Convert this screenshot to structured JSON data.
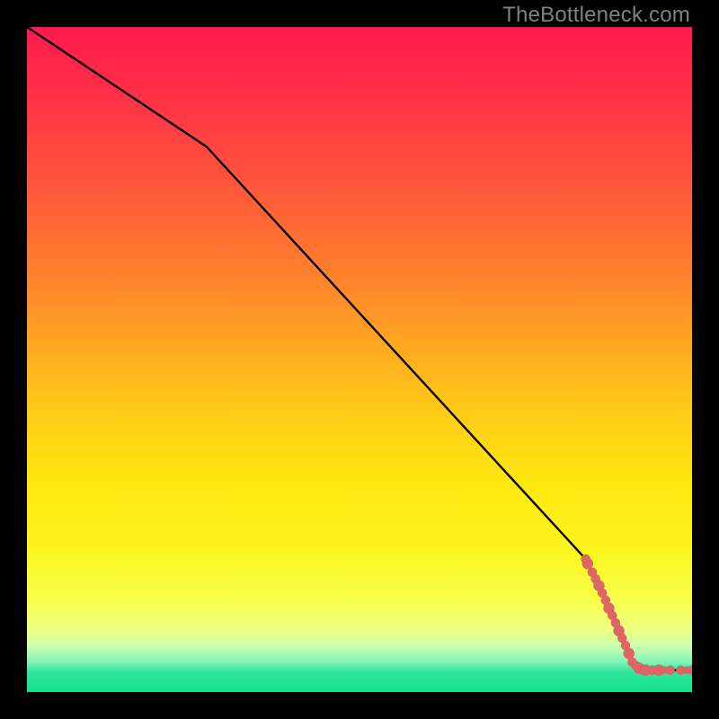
{
  "watermark": "TheBottleneck.com",
  "colors": {
    "line": "#000000",
    "dot_fill": "#e06666",
    "dot_stroke": "#d65a5a",
    "plot_border": "#000000"
  },
  "chart_data": {
    "type": "line",
    "title": "",
    "xlabel": "",
    "ylabel": "",
    "xlim": [
      0,
      100
    ],
    "ylim": [
      0,
      100
    ],
    "line": [
      {
        "x": 0,
        "y": 100
      },
      {
        "x": 27,
        "y": 82
      },
      {
        "x": 84,
        "y": 20
      },
      {
        "x": 91,
        "y": 4.5
      },
      {
        "x": 93,
        "y": 3.3
      },
      {
        "x": 100,
        "y": 3.3
      }
    ],
    "dots": [
      {
        "x": 84.0,
        "y": 20.0,
        "r": 5
      },
      {
        "x": 84.3,
        "y": 19.3,
        "r": 6
      },
      {
        "x": 85.0,
        "y": 18.0,
        "r": 5
      },
      {
        "x": 85.5,
        "y": 17.0,
        "r": 5
      },
      {
        "x": 86.0,
        "y": 16.0,
        "r": 6
      },
      {
        "x": 86.5,
        "y": 14.9,
        "r": 5
      },
      {
        "x": 87.0,
        "y": 13.8,
        "r": 5
      },
      {
        "x": 87.5,
        "y": 12.6,
        "r": 6
      },
      {
        "x": 88.0,
        "y": 11.5,
        "r": 5
      },
      {
        "x": 88.5,
        "y": 10.4,
        "r": 5
      },
      {
        "x": 89.0,
        "y": 9.2,
        "r": 6
      },
      {
        "x": 89.5,
        "y": 8.1,
        "r": 5
      },
      {
        "x": 90.0,
        "y": 7.0,
        "r": 5
      },
      {
        "x": 90.5,
        "y": 5.8,
        "r": 6
      },
      {
        "x": 91.0,
        "y": 4.5,
        "r": 5
      },
      {
        "x": 91.5,
        "y": 4.0,
        "r": 5
      },
      {
        "x": 92.0,
        "y": 3.6,
        "r": 6
      },
      {
        "x": 92.5,
        "y": 3.4,
        "r": 5
      },
      {
        "x": 93.0,
        "y": 3.3,
        "r": 6
      },
      {
        "x": 94.0,
        "y": 3.3,
        "r": 5
      },
      {
        "x": 95.0,
        "y": 3.3,
        "r": 6
      },
      {
        "x": 95.8,
        "y": 3.3,
        "r": 4
      },
      {
        "x": 96.7,
        "y": 3.3,
        "r": 5
      },
      {
        "x": 98.3,
        "y": 3.3,
        "r": 5
      },
      {
        "x": 99.2,
        "y": 3.3,
        "r": 4
      },
      {
        "x": 100,
        "y": 3.3,
        "r": 5
      }
    ],
    "gradient_stops": [
      {
        "p": 0.0,
        "c": "#ff1a4d"
      },
      {
        "p": 0.1,
        "c": "#ff3047"
      },
      {
        "p": 0.25,
        "c": "#ff5a3a"
      },
      {
        "p": 0.4,
        "c": "#ff8a2a"
      },
      {
        "p": 0.55,
        "c": "#ffc21a"
      },
      {
        "p": 0.68,
        "c": "#ffe60f"
      },
      {
        "p": 0.78,
        "c": "#fcf51a"
      },
      {
        "p": 0.86,
        "c": "#f7ff4a"
      },
      {
        "p": 0.905,
        "c": "#eeff80"
      },
      {
        "p": 0.93,
        "c": "#ccffb0"
      },
      {
        "p": 0.955,
        "c": "#7ff4b8"
      },
      {
        "p": 0.97,
        "c": "#2ee69d"
      },
      {
        "p": 1.0,
        "c": "#14e08a"
      }
    ]
  }
}
